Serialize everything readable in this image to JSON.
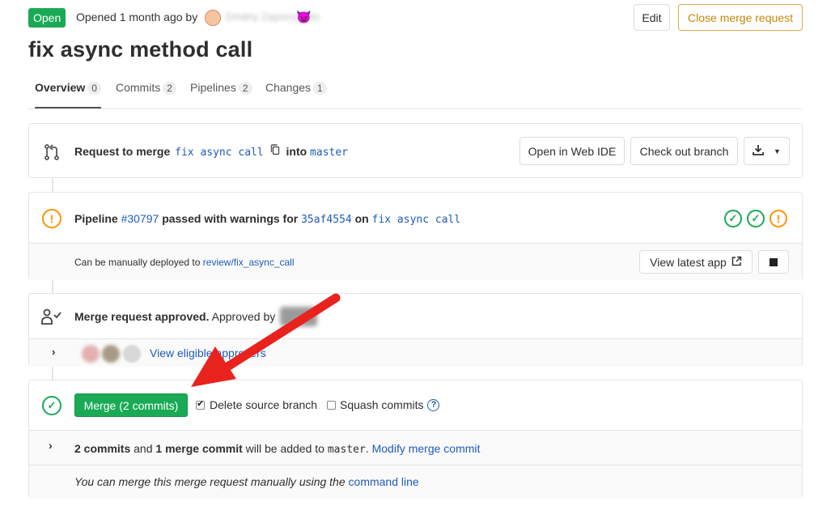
{
  "header": {
    "status_badge": "Open",
    "opened_text": "Opened 1 month ago by",
    "author_name": "Dmitriy Zaporozhets",
    "edit_label": "Edit",
    "close_label": "Close merge request"
  },
  "title": "fix async method call",
  "tabs": [
    {
      "label": "Overview",
      "count": "0"
    },
    {
      "label": "Commits",
      "count": "2"
    },
    {
      "label": "Pipelines",
      "count": "2"
    },
    {
      "label": "Changes",
      "count": "1"
    }
  ],
  "merge_request": {
    "request_to_merge": "Request to merge",
    "source_branch": "fix async call",
    "into": "into",
    "target_branch": "master",
    "open_web_ide": "Open in Web IDE",
    "checkout_branch": "Check out branch"
  },
  "pipeline": {
    "label": "Pipeline",
    "id": "#30797",
    "status_text": "passed with warnings for",
    "commit": "35af4554",
    "on": "on",
    "branch": "fix async call",
    "deploy_text": "Can be manually deployed to",
    "deploy_env": "review/fix_async_call",
    "view_latest_app": "View latest app"
  },
  "approval": {
    "approved_bold": "Merge request approved.",
    "approved_by": "Approved by",
    "view_eligible": "View eligible approvers"
  },
  "merge": {
    "button_label": "Merge (2 commits)",
    "delete_source": "Delete source branch",
    "delete_source_checked": true,
    "squash_commits": "Squash commits",
    "squash_checked": false,
    "commits_bold": "2 commits",
    "and": "and",
    "merge_commit_bold": "1 merge commit",
    "added_to": "will be added to",
    "target": "master",
    "period": ".",
    "modify_link": "Modify merge commit",
    "manual_text": "You can merge this merge request manually using the",
    "command_line": "command line"
  },
  "colors": {
    "green": "#1aaa55",
    "warning": "#fc9403",
    "link": "#1f5bb8",
    "arrow": "#e8231e"
  }
}
